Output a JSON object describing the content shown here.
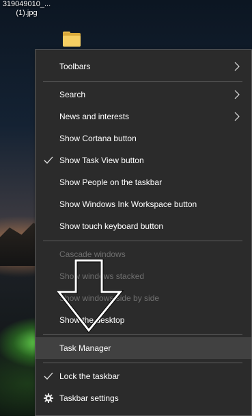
{
  "desktop": {
    "file_label_line1": "319049010_...",
    "file_label_line2": "(1).jpg"
  },
  "menu": {
    "toolbars": "Toolbars",
    "search": "Search",
    "news_interests": "News and interests",
    "show_cortana": "Show Cortana button",
    "show_task_view": "Show Task View button",
    "show_people": "Show People on the taskbar",
    "show_ink_workspace": "Show Windows Ink Workspace button",
    "show_touch_keyboard": "Show touch keyboard button",
    "cascade_windows": "Cascade windows",
    "show_windows_stacked": "Show windows stacked",
    "show_windows_side": "Show windows side by side",
    "show_desktop": "Show the desktop",
    "task_manager": "Task Manager",
    "lock_taskbar": "Lock the taskbar",
    "taskbar_settings": "Taskbar settings"
  },
  "state": {
    "task_view_checked": true,
    "lock_taskbar_checked": true,
    "highlighted_item": "Task Manager"
  },
  "colors": {
    "menu_bg": "#2b2b2b",
    "menu_text": "#ffffff",
    "disabled_text": "#6f6f6f",
    "highlight_bg": "#414141",
    "separator": "#5e5e5e"
  }
}
